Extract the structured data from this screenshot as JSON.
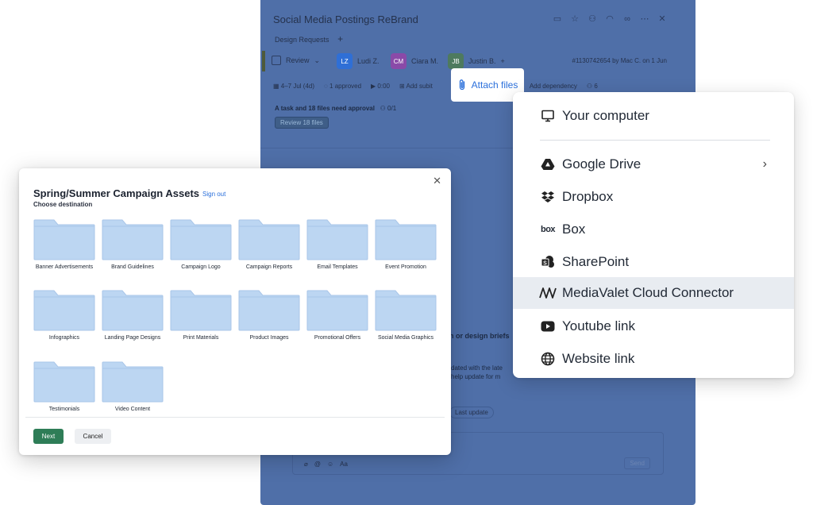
{
  "task": {
    "title": "Social Media Postings ReBrand",
    "subtab": "Design Requests",
    "status": "Review",
    "assignees": [
      {
        "initials": "LZ",
        "name": "Ludi Z.",
        "color": "#2f6fd6"
      },
      {
        "initials": "CM",
        "name": "Ciara M.",
        "color": "#8a4aa8"
      },
      {
        "initials": "JB",
        "name": "Justin B.",
        "color": "#4e7a5e"
      }
    ],
    "id_text": "#1130742654 by Mac C. on 1 Jun",
    "dates": "4–7 Jul (4d)",
    "approved": "1 approved",
    "time": "0:00",
    "add_subitem": "Add subit",
    "add_dependency": "Add dependency",
    "followers": "6",
    "approval_text": "A task and 18 files need approval",
    "approval_count": "0/1",
    "review_files": "Review 18 files",
    "bg_heading": "n or design briefs",
    "bg_line1": "dated with the late",
    "bg_line2": "help update for m",
    "last_update": "Last update",
    "send": "Send",
    "aa": "Aa"
  },
  "attach": {
    "label": "Attach files",
    "color": "#2a6fdb"
  },
  "menu": {
    "items": [
      {
        "label": "Your computer",
        "icon": "monitor-icon"
      },
      {
        "label": "Google Drive",
        "icon": "google-drive-icon",
        "has_submenu": true
      },
      {
        "label": "Dropbox",
        "icon": "dropbox-icon"
      },
      {
        "label": "Box",
        "icon": "box-icon"
      },
      {
        "label": "SharePoint",
        "icon": "sharepoint-icon"
      },
      {
        "label": "MediaValet Cloud Connector",
        "icon": "mediavalet-icon",
        "highlighted": true
      },
      {
        "label": "Youtube link",
        "icon": "youtube-icon"
      },
      {
        "label": "Website link",
        "icon": "globe-icon"
      }
    ]
  },
  "dialog": {
    "title": "Spring/Summer Campaign Assets",
    "signout": "Sign out",
    "subtitle": "Choose destination",
    "folders": [
      "Banner Advertisements",
      "Brand Guidelines",
      "Campaign Logo",
      "Campaign Reports",
      "Email Templates",
      "Event Promotion",
      "Infographics",
      "Landing Page Designs",
      "Print Materials",
      "Product Images",
      "Promotional Offers",
      "Social Media Graphics",
      "Testimonials",
      "Video Content"
    ],
    "next": "Next",
    "cancel": "Cancel",
    "primary_color": "#2e7d57",
    "folder_color": "#bcd6f2"
  }
}
